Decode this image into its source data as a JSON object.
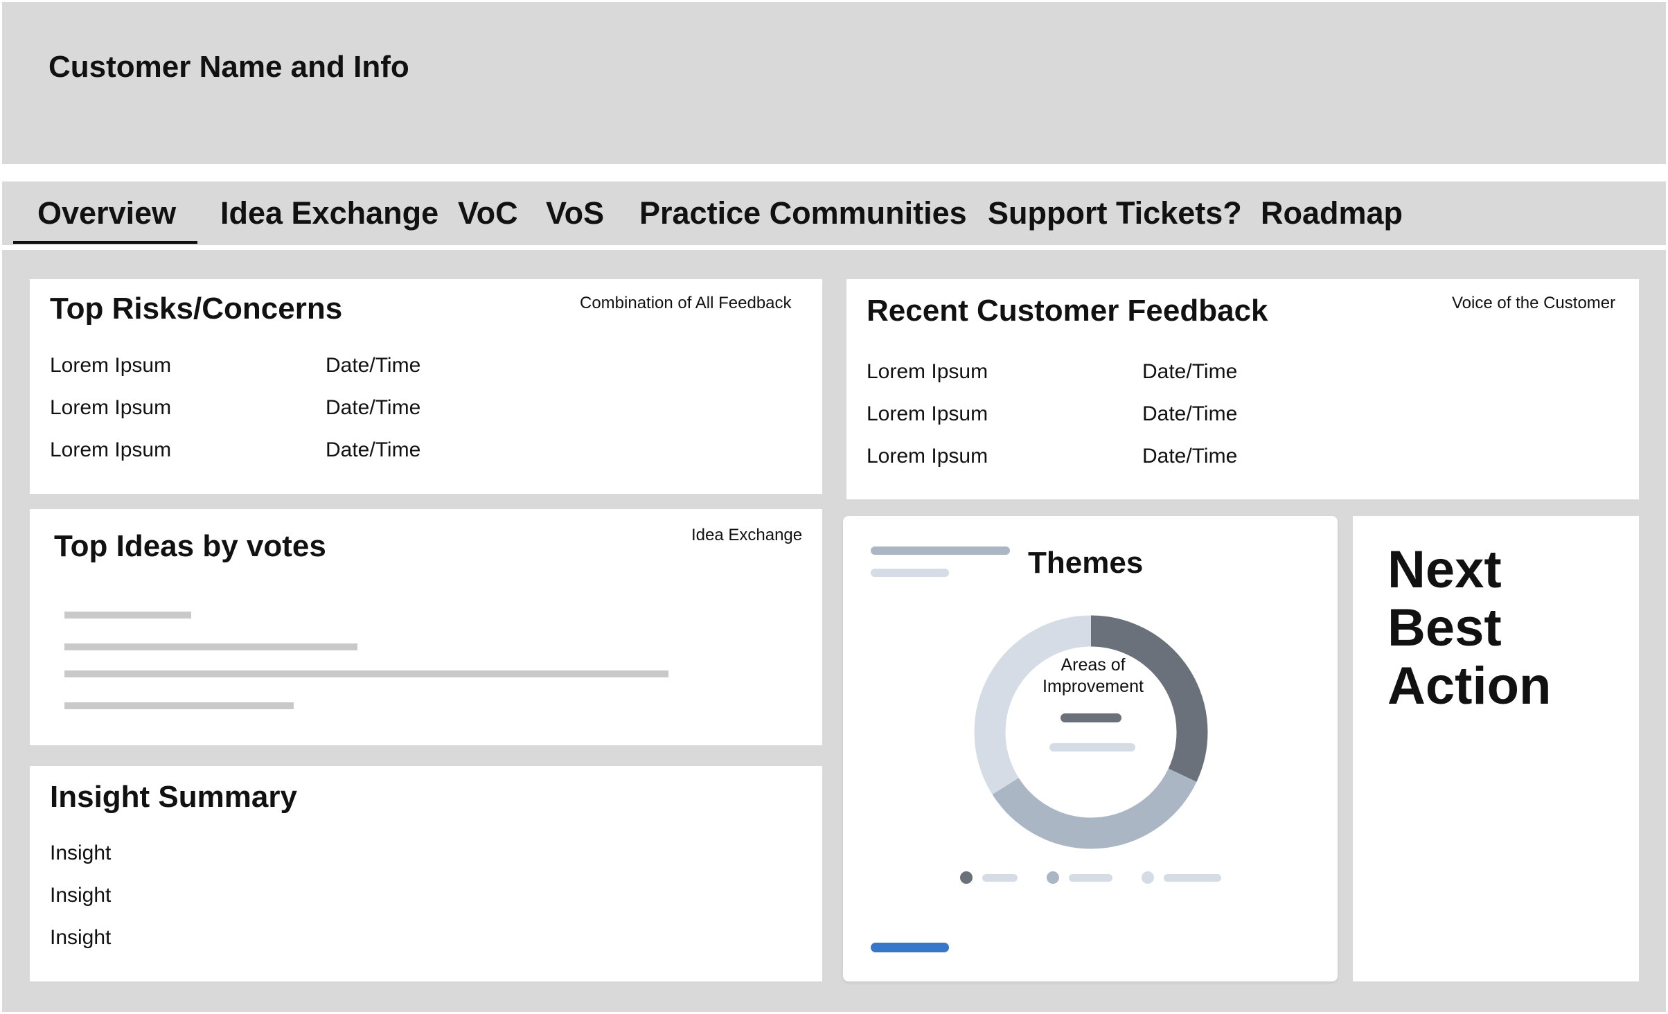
{
  "header": {
    "title": "Customer Name and Info"
  },
  "tabs": [
    {
      "label": "Overview",
      "active": true
    },
    {
      "label": "Idea Exchange"
    },
    {
      "label": "VoC"
    },
    {
      "label": "VoS"
    },
    {
      "label": "Practice Communities"
    },
    {
      "label": "Support Tickets?"
    },
    {
      "label": "Roadmap"
    }
  ],
  "risks": {
    "title": "Top Risks/Concerns",
    "note": "Combination of All Feedback",
    "rows": [
      {
        "item": "Lorem Ipsum",
        "date": "Date/Time"
      },
      {
        "item": "Lorem Ipsum",
        "date": "Date/Time"
      },
      {
        "item": "Lorem Ipsum",
        "date": "Date/Time"
      }
    ]
  },
  "feedback": {
    "title": "Recent Customer Feedback",
    "note": "Voice of the Customer",
    "rows": [
      {
        "item": "Lorem Ipsum",
        "date": "Date/Time"
      },
      {
        "item": "Lorem Ipsum",
        "date": "Date/Time"
      },
      {
        "item": "Lorem Ipsum",
        "date": "Date/Time"
      }
    ]
  },
  "ideas": {
    "title": "Top Ideas by votes",
    "note": "Idea Exchange",
    "bar_fractions": [
      0.21,
      0.485,
      1.0,
      0.38
    ]
  },
  "insights": {
    "title": "Insight Summary",
    "rows": [
      "Insight",
      "Insight",
      "Insight"
    ]
  },
  "themes": {
    "title": "Themes",
    "donut_center_label": "Areas of Improvement",
    "segments": [
      {
        "fraction": 0.32,
        "color": "#6b717a"
      },
      {
        "fraction": 0.34,
        "color": "#aab6c4"
      },
      {
        "fraction": 0.34,
        "color": "#d5dce5"
      }
    ],
    "accent_color": "#3a76c8"
  },
  "next_action": {
    "line1": "Next",
    "line2": "Best",
    "line3": "Action"
  }
}
